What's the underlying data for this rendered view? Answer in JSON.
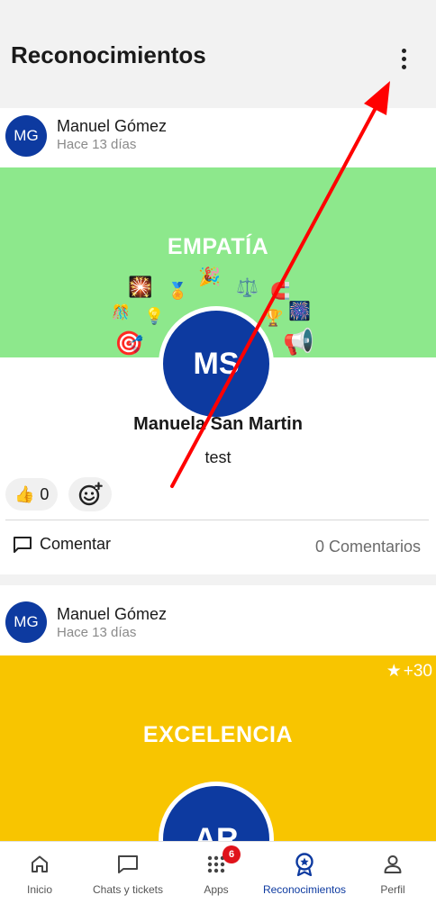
{
  "header": {
    "title": "Reconocimientos",
    "menu_icon": "more-vertical-icon"
  },
  "posts": [
    {
      "author": {
        "initials": "MG",
        "name": "Manuel Gómez",
        "date": "Hace 13 días"
      },
      "value": "EMPATÍA",
      "banner_color": "#8de88c",
      "recipient": {
        "initials": "MS",
        "name": "Manuela San Martin"
      },
      "message": "test",
      "reactions": {
        "emoji": "👍",
        "count": "0"
      },
      "comment_label": "Comentar",
      "comment_count": "0 Comentarios"
    },
    {
      "author": {
        "initials": "MG",
        "name": "Manuel Gómez",
        "date": "Hace 13 días"
      },
      "value": "EXCELENCIA",
      "banner_color": "#f8c500",
      "points": "+30",
      "recipient": {
        "initials": "AR"
      }
    }
  ],
  "bottom_nav": {
    "items": [
      {
        "label": "Inicio",
        "icon": "home-icon"
      },
      {
        "label": "Chats y tickets",
        "icon": "chat-icon"
      },
      {
        "label": "Apps",
        "icon": "apps-grid-icon",
        "badge": "6"
      },
      {
        "label": "Reconocimientos",
        "icon": "award-icon",
        "active": true
      },
      {
        "label": "Perfil",
        "icon": "user-icon"
      }
    ]
  },
  "colors": {
    "primary": "#0d3aa0",
    "badge": "#e0131b",
    "annotation_arrow": "#ff0000"
  }
}
